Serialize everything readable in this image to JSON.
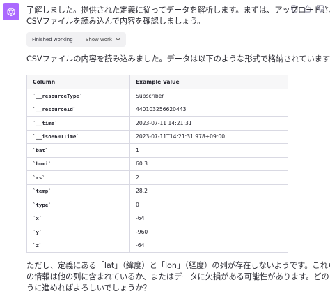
{
  "message": {
    "intro_line1": "了解しました。提供された定義に従ってデータを解析します。まずは、アップロードされた",
    "intro_line2": "CSVファイルを読み込んで内容を確認しましょう。",
    "working_label": "Finished working",
    "show_work_label": "Show work",
    "loaded_line": "CSVファイルの内容を読み込みました。データは以下のような形式で格納されています：",
    "outro_line1": "ただし、定義にある「lat」（緯度）と「lon」（経度）の列が存在しないようです。これら",
    "outro_line2": "の情報は他の列に含まれているか、またはデータに欠損がある可能性があります。どのよ",
    "outro_line3": "うに進めればよろしいでしょうか？"
  },
  "table": {
    "headers": [
      "Column",
      "Example Value"
    ],
    "rows": [
      [
        "`__resourceType`",
        "Subscriber"
      ],
      [
        "`__resourceId`",
        "440103256620443"
      ],
      [
        "`__time`",
        "2023-07-11 14:21:31"
      ],
      [
        "`__iso8601Time`",
        "2023-07-11T14:21:31.978+09:00"
      ],
      [
        "`bat`",
        "1"
      ],
      [
        "`humi`",
        "60.3"
      ],
      [
        "`rs`",
        "2"
      ],
      [
        "`temp`",
        "28.2"
      ],
      [
        "`type`",
        "0"
      ],
      [
        "`x`",
        "-64"
      ],
      [
        "`y`",
        "-960"
      ],
      [
        "`z`",
        "-64"
      ]
    ]
  },
  "icons": {
    "avatar": "chatgpt-logo-icon",
    "copy": "copy-icon",
    "thumbs_up": "thumbs-up-icon",
    "thumbs_down": "thumbs-down-icon",
    "chevron": "chevron-down-icon"
  },
  "colors": {
    "avatar_bg": "#ab68ff"
  }
}
